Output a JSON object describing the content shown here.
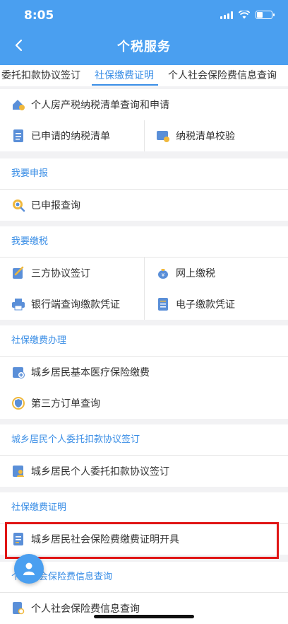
{
  "status_bar": {
    "time": "8:05"
  },
  "header": {
    "title": "个税服务"
  },
  "tabs": [
    {
      "label": "委托扣款协议签订",
      "active": false
    },
    {
      "label": "社保缴费证明",
      "active": true
    },
    {
      "label": "个人社会保险费信息查询",
      "active": false
    }
  ],
  "top_group": {
    "house_tax": "个人房产税纳税清单查询和申请",
    "applied_list": "已申请的纳税清单",
    "list_verify": "纳税清单校验"
  },
  "section_declare": {
    "title": "我要申报",
    "declared_query": "已申报查询"
  },
  "section_pay": {
    "title": "我要缴税",
    "tripartite": "三方协议签订",
    "online_pay": "网上缴税",
    "bank_voucher": "银行端查询缴款凭证",
    "e_voucher": "电子缴款凭证"
  },
  "section_social": {
    "title": "社保缴费办理",
    "medical": "城乡居民基本医疗保险缴费",
    "third_party": "第三方订单查询"
  },
  "section_entrust": {
    "title": "城乡居民个人委托扣款协议签订",
    "entrust_item": "城乡居民个人委托扣款协议签订"
  },
  "section_certificate": {
    "title": "社保缴费证明",
    "cert_item": "城乡居民社会保险费缴费证明开具"
  },
  "section_info": {
    "title": "个人社会保险费信息查询",
    "info_item": "个人社会保险费信息查询"
  },
  "colors": {
    "brand": "#4a9ff0",
    "accent": "#3a8ee6",
    "highlight": "#e01515"
  }
}
